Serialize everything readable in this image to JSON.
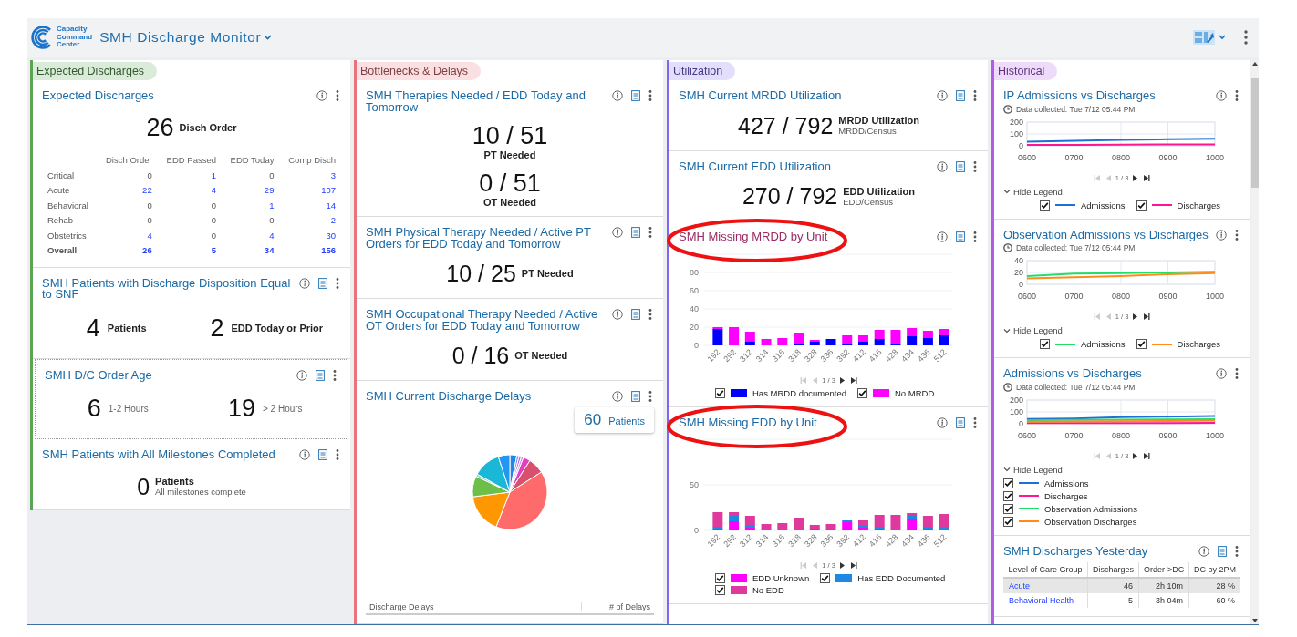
{
  "header": {
    "logo_lines": [
      "Capacity",
      "Command",
      "Center"
    ],
    "title": "SMH Discharge Monitor"
  },
  "columns": [
    {
      "section": "Expected Discharges",
      "color": "#5aa454",
      "cards": [
        {
          "kind": "summary_table",
          "title": "Expected Discharges",
          "report": false,
          "focused": false,
          "hovered": false,
          "circled": false,
          "stat": {
            "value": "26",
            "label": "Disch Order"
          },
          "table": {
            "columns": [
              "Disch Order",
              "EDD Passed",
              "EDD Today",
              "Comp Disch"
            ],
            "rows": [
              {
                "label": "Critical",
                "cells": [
                  "0",
                  "1",
                  "0",
                  "3"
                ],
                "linked": [
                  false,
                  true,
                  false,
                  true
                ],
                "total": false
              },
              {
                "label": "Acute",
                "cells": [
                  "22",
                  "4",
                  "29",
                  "107"
                ],
                "linked": [
                  true,
                  true,
                  true,
                  true
                ],
                "total": false
              },
              {
                "label": "Behavioral",
                "cells": [
                  "0",
                  "0",
                  "1",
                  "14"
                ],
                "linked": [
                  false,
                  false,
                  true,
                  true
                ],
                "total": false
              },
              {
                "label": "Rehab",
                "cells": [
                  "0",
                  "0",
                  "0",
                  "2"
                ],
                "linked": [
                  false,
                  false,
                  false,
                  true
                ],
                "total": false
              },
              {
                "label": "Obstetrics",
                "cells": [
                  "4",
                  "0",
                  "4",
                  "30"
                ],
                "linked": [
                  true,
                  false,
                  true,
                  true
                ],
                "total": false
              },
              {
                "label": "Overall",
                "cells": [
                  "26",
                  "5",
                  "34",
                  "156"
                ],
                "linked": [
                  true,
                  true,
                  true,
                  true
                ],
                "total": true
              }
            ]
          }
        },
        {
          "kind": "split",
          "title": "SMH Patients with Discharge Disposition Equal to SNF",
          "report": true,
          "focused": false,
          "hovered": false,
          "circled": false,
          "muted_labels": false,
          "stats": [
            {
              "value": "4",
              "label": "Patients"
            },
            {
              "value": "2",
              "label": "EDD Today or Prior"
            }
          ]
        },
        {
          "kind": "split",
          "title": "SMH D/C Order Age",
          "report": true,
          "focused": true,
          "hovered": false,
          "circled": false,
          "muted_labels": true,
          "stats": [
            {
              "value": "6",
              "label": "1-2 Hours"
            },
            {
              "value": "19",
              "label": "> 2 Hours"
            }
          ]
        },
        {
          "kind": "stat_note",
          "title": "SMH Patients with All Milestones Completed",
          "report": true,
          "focused": false,
          "hovered": false,
          "circled": false,
          "stat": {
            "value": "0",
            "label": "Patients",
            "note": "All milestones complete"
          }
        }
      ]
    },
    {
      "section": "Bottlenecks & Delays",
      "color": "#e8737a",
      "cards": [
        {
          "kind": "ratio",
          "title": "SMH Therapies Needed / EDD Today and Tomorrow",
          "report": true,
          "focused": false,
          "hovered": false,
          "circled": false,
          "stats": [
            {
              "kind": "stacked",
              "value": "10 / 51",
              "label": "PT Needed"
            },
            {
              "kind": "stacked",
              "value": "0 / 51",
              "label": "OT Needed"
            }
          ]
        },
        {
          "kind": "ratio",
          "title": "SMH Physical Therapy Needed / Active PT Orders for EDD Today and Tomorrow",
          "report": true,
          "focused": false,
          "hovered": false,
          "circled": false,
          "stats": [
            {
              "kind": "beside",
              "value": "10 / 25",
              "label": "PT Needed"
            }
          ]
        },
        {
          "kind": "ratio",
          "title": "SMH Occupational Therapy Needed / Active OT Orders for EDD Today and Tomorrow",
          "report": true,
          "focused": false,
          "hovered": false,
          "circled": false,
          "stats": [
            {
              "kind": "beside",
              "value": "0 / 16",
              "label": "OT Needed"
            }
          ]
        },
        {
          "kind": "pie",
          "title": "SMH Current Discharge Delays",
          "report": true,
          "focused": false,
          "hovered": false,
          "circled": false,
          "badge": {
            "value": "60",
            "label": "Patients"
          },
          "table_columns": [
            "Discharge Delays",
            "# of Delays"
          ]
        }
      ]
    },
    {
      "section": "Utilization",
      "color": "#7b68ee",
      "cards": [
        {
          "kind": "ratio",
          "title": "SMH Current MRDD Utilization",
          "report": true,
          "focused": false,
          "hovered": false,
          "circled": false,
          "stats": [
            {
              "kind": "beside",
              "value": "427 / 792",
              "label": "MRDD Utilization",
              "sublabel": "MRDD/Census"
            }
          ]
        },
        {
          "kind": "ratio",
          "title": "SMH Current EDD Utilization",
          "report": true,
          "focused": false,
          "hovered": false,
          "circled": false,
          "stats": [
            {
              "kind": "beside",
              "value": "270 / 792",
              "label": "EDD Utilization",
              "sublabel": "EDD/Census"
            }
          ]
        },
        {
          "kind": "bar_chart",
          "title": "SMH Missing MRDD by Unit",
          "report": true,
          "focused": false,
          "hovered": true,
          "circled": true,
          "pager": "1 / 3",
          "legend": [
            {
              "checked": true
            },
            {
              "checked": true
            }
          ],
          "chart_data": {
            "type": "bar",
            "stacked": true,
            "grid": true,
            "categories": [
              "192",
              "292",
              "312",
              "314",
              "316",
              "318",
              "328",
              "336",
              "392",
              "412",
              "416",
              "428",
              "434",
              "436",
              "512"
            ],
            "ylim": [
              0,
              100
            ],
            "yticks": [
              0,
              20,
              40,
              60,
              80
            ],
            "series": [
              {
                "name": "Has MRDD documented",
                "color": "#0000ff",
                "values": [
                  18,
                  0,
                  4,
                  0,
                  0,
                  2,
                  4,
                  7,
                  2,
                  4,
                  7,
                  2,
                  10,
                  8,
                  11
                ]
              },
              {
                "name": "No MRDD",
                "color": "#ff00ff",
                "values": [
                  2,
                  20,
                  11,
                  7,
                  8,
                  12,
                  2,
                  0,
                  9,
                  7,
                  10,
                  15,
                  9,
                  8,
                  7
                ]
              }
            ]
          }
        },
        {
          "kind": "bar_chart",
          "title": "SMH Missing EDD by Unit",
          "report": true,
          "focused": false,
          "hovered": false,
          "circled": true,
          "pager": "1 / 3",
          "legend": [
            {
              "checked": true
            },
            {
              "checked": true
            },
            {
              "checked": true
            }
          ],
          "chart_data": {
            "type": "bar",
            "stacked": true,
            "grid": true,
            "categories": [
              "192",
              "292",
              "312",
              "314",
              "316",
              "318",
              "328",
              "336",
              "392",
              "412",
              "416",
              "428",
              "434",
              "436",
              "512"
            ],
            "ylim": [
              0,
              100
            ],
            "yticks": [
              0,
              50
            ],
            "series": [
              {
                "name": "EDD Unknown",
                "color": "#ff00ff",
                "values": [
                  2,
                  10,
                  3,
                  0,
                  0,
                  0,
                  2,
                  0,
                  9,
                  3,
                  2,
                  0,
                  13,
                  2,
                  0
                ]
              },
              {
                "name": "Has EDD Documented",
                "color": "#1e88e5",
                "values": [
                  2,
                  6,
                  3,
                  0,
                  0,
                  0,
                  0,
                  2,
                  2,
                  2,
                  2,
                  0,
                  4,
                  2,
                  3
                ]
              },
              {
                "name": "No EDD",
                "color": "#de3a9e",
                "values": [
                  16,
                  4,
                  10,
                  7,
                  8,
                  14,
                  4,
                  5,
                  0,
                  6,
                  13,
                  17,
                  2,
                  12,
                  15
                ]
              }
            ]
          }
        }
      ]
    },
    {
      "section": "Historical",
      "color": "#b05ce6",
      "cards": [
        {
          "kind": "line_chart",
          "title": "IP Admissions vs Discharges",
          "report": false,
          "focused": false,
          "hovered": false,
          "circled": false,
          "collected": "Data collected: Tue 7/12 05:44 PM",
          "pager": "1 / 3",
          "legend_toggle": "Hide Legend",
          "legend_stacked": false,
          "legend": [
            {
              "checked": true
            },
            {
              "checked": true
            }
          ],
          "chart_data": {
            "type": "line",
            "grid": true,
            "x": [
              "0600",
              "0700",
              "0800",
              "0900",
              "1000"
            ],
            "ylim": [
              0,
              200
            ],
            "yticks": [
              0,
              100,
              200
            ],
            "series": [
              {
                "name": "Admissions",
                "color": "#1f6fd6",
                "values": [
                  35,
                  42,
                  50,
                  55,
                  60
                ]
              },
              {
                "name": "Discharges",
                "color": "#ff1493",
                "values": [
                  8,
                  8,
                  9,
                  11,
                  12
                ]
              }
            ]
          }
        },
        {
          "kind": "line_chart",
          "title": "Observation Admissions vs Discharges",
          "report": false,
          "focused": false,
          "hovered": false,
          "circled": false,
          "collected": "Data collected: Tue 7/12 05:44 PM",
          "pager": "1 / 3",
          "legend_toggle": "Hide Legend",
          "legend_stacked": false,
          "legend": [
            {
              "checked": true
            },
            {
              "checked": true
            }
          ],
          "chart_data": {
            "type": "line",
            "grid": true,
            "x": [
              "0600",
              "0700",
              "0800",
              "0900",
              "1000"
            ],
            "ylim": [
              0,
              40
            ],
            "yticks": [
              0,
              20,
              40
            ],
            "series": [
              {
                "name": "Admissions",
                "color": "#22dd66",
                "values": [
                  14,
                  18,
                  19,
                  20,
                  21
                ]
              },
              {
                "name": "Discharges",
                "color": "#ff8c1a",
                "values": [
                  10,
                  12,
                  14,
                  17,
                  19
                ]
              }
            ]
          }
        },
        {
          "kind": "line_chart",
          "title": "Admissions vs Discharges",
          "report": false,
          "focused": false,
          "hovered": false,
          "circled": false,
          "collected": "Data collected: Tue 7/12 05:44 PM",
          "pager": "1 / 3",
          "legend_toggle": "Hide Legend",
          "legend_stacked": true,
          "legend": [
            {
              "checked": true
            },
            {
              "checked": true
            },
            {
              "checked": true
            },
            {
              "checked": true
            }
          ],
          "chart_data": {
            "type": "line",
            "grid": true,
            "x": [
              "0600",
              "0700",
              "0800",
              "0900",
              "1000"
            ],
            "ylim": [
              0,
              200
            ],
            "yticks": [
              0,
              100,
              200
            ],
            "series": [
              {
                "name": "Admissions",
                "color": "#1f6fd6",
                "values": [
                  40,
                  45,
                  55,
                  60,
                  65
                ]
              },
              {
                "name": "Discharges",
                "color": "#ff1493",
                "values": [
                  5,
                  5,
                  6,
                  6,
                  7
                ]
              },
              {
                "name": "Observation Admissions",
                "color": "#22dd66",
                "values": [
                  30,
                  32,
                  34,
                  36,
                  38
                ]
              },
              {
                "name": "Observation Discharges",
                "color": "#ff8c1a",
                "values": [
                  18,
                  20,
                  22,
                  24,
                  26
                ]
              }
            ]
          }
        },
        {
          "kind": "table",
          "title": "SMH Discharges Yesterday",
          "report": true,
          "focused": false,
          "hovered": false,
          "circled": false,
          "columns": [
            "Level of Care Group",
            "Discharges",
            "Order->DC",
            "DC by 2PM"
          ],
          "rows": [
            {
              "cells": [
                "Acute",
                "46",
                "2h 10m",
                "28 %"
              ],
              "selected": true
            },
            {
              "cells": [
                "Behavioral Health",
                "5",
                "3h 04m",
                "60 %"
              ],
              "selected": false
            }
          ]
        }
      ]
    }
  ]
}
